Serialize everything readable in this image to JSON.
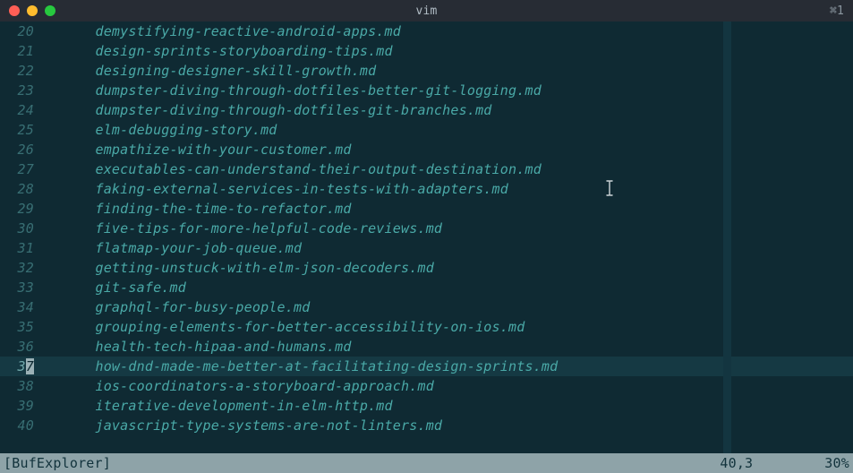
{
  "titlebar": {
    "title": "vim",
    "right_glyph": "⌘1"
  },
  "editor": {
    "current_line_number": 37,
    "cursor_char_index": 1,
    "lines": [
      {
        "number": 20,
        "text": "demystifying-reactive-android-apps.md"
      },
      {
        "number": 21,
        "text": "design-sprints-storyboarding-tips.md"
      },
      {
        "number": 22,
        "text": "designing-designer-skill-growth.md"
      },
      {
        "number": 23,
        "text": "dumpster-diving-through-dotfiles-better-git-logging.md"
      },
      {
        "number": 24,
        "text": "dumpster-diving-through-dotfiles-git-branches.md"
      },
      {
        "number": 25,
        "text": "elm-debugging-story.md"
      },
      {
        "number": 26,
        "text": "empathize-with-your-customer.md"
      },
      {
        "number": 27,
        "text": "executables-can-understand-their-output-destination.md"
      },
      {
        "number": 28,
        "text": "faking-external-services-in-tests-with-adapters.md"
      },
      {
        "number": 29,
        "text": "finding-the-time-to-refactor.md"
      },
      {
        "number": 30,
        "text": "five-tips-for-more-helpful-code-reviews.md"
      },
      {
        "number": 31,
        "text": "flatmap-your-job-queue.md"
      },
      {
        "number": 32,
        "text": "getting-unstuck-with-elm-json-decoders.md"
      },
      {
        "number": 33,
        "text": "git-safe.md"
      },
      {
        "number": 34,
        "text": "graphql-for-busy-people.md"
      },
      {
        "number": 35,
        "text": "grouping-elements-for-better-accessibility-on-ios.md"
      },
      {
        "number": 36,
        "text": "health-tech-hipaa-and-humans.md"
      },
      {
        "number": 37,
        "text": "how-dnd-made-me-better-at-facilitating-design-sprints.md"
      },
      {
        "number": 38,
        "text": "ios-coordinators-a-storyboard-approach.md"
      },
      {
        "number": 39,
        "text": "iterative-development-in-elm-http.md"
      },
      {
        "number": 40,
        "text": "javascript-type-systems-are-not-linters.md"
      }
    ]
  },
  "statusbar": {
    "left": "[BufExplorer]",
    "position": "40,3",
    "percent": "30%"
  },
  "colors": {
    "text": "#4aa9a7",
    "gutter": "#386e73",
    "highlight_bg": "#153943",
    "statusbar_bg": "#8ea3a8",
    "statusbar_fg": "#12333c",
    "background": "#0f2a33"
  }
}
